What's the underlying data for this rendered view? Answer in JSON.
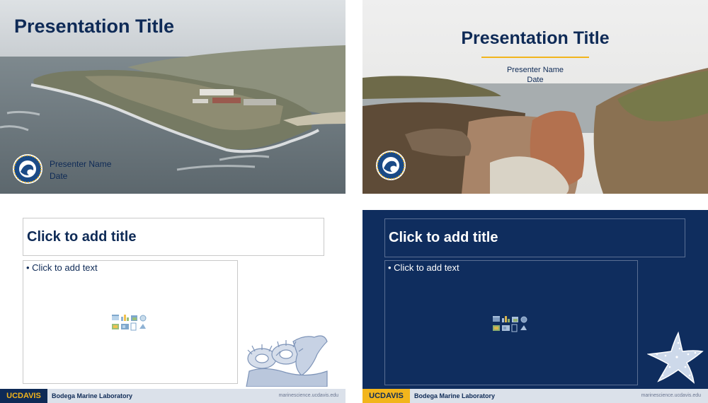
{
  "slides": [
    {
      "title": "Presentation Title",
      "presenter": "Presenter Name",
      "date": "Date"
    },
    {
      "title": "Presentation Title",
      "presenter": "Presenter Name",
      "date": "Date"
    },
    {
      "title": "Click to add title",
      "body": "• Click to add text"
    },
    {
      "title": "Click to add title",
      "body": "• Click to add text"
    }
  ],
  "footer": {
    "logo": "UCDAVIS",
    "lab": "Bodega Marine Laboratory",
    "url": "marinescience.ucdavis.edu"
  },
  "colors": {
    "navy": "#0e2a56",
    "gold": "#f2b51c",
    "slide_dark_bg": "#0f2d5e",
    "footer_bg": "#dbe1ea"
  },
  "icons": {
    "seal": "seal-icon",
    "placeholder": "content-placeholder-icons",
    "anemone": "anemone-illustration",
    "starfish": "starfish-illustration"
  }
}
